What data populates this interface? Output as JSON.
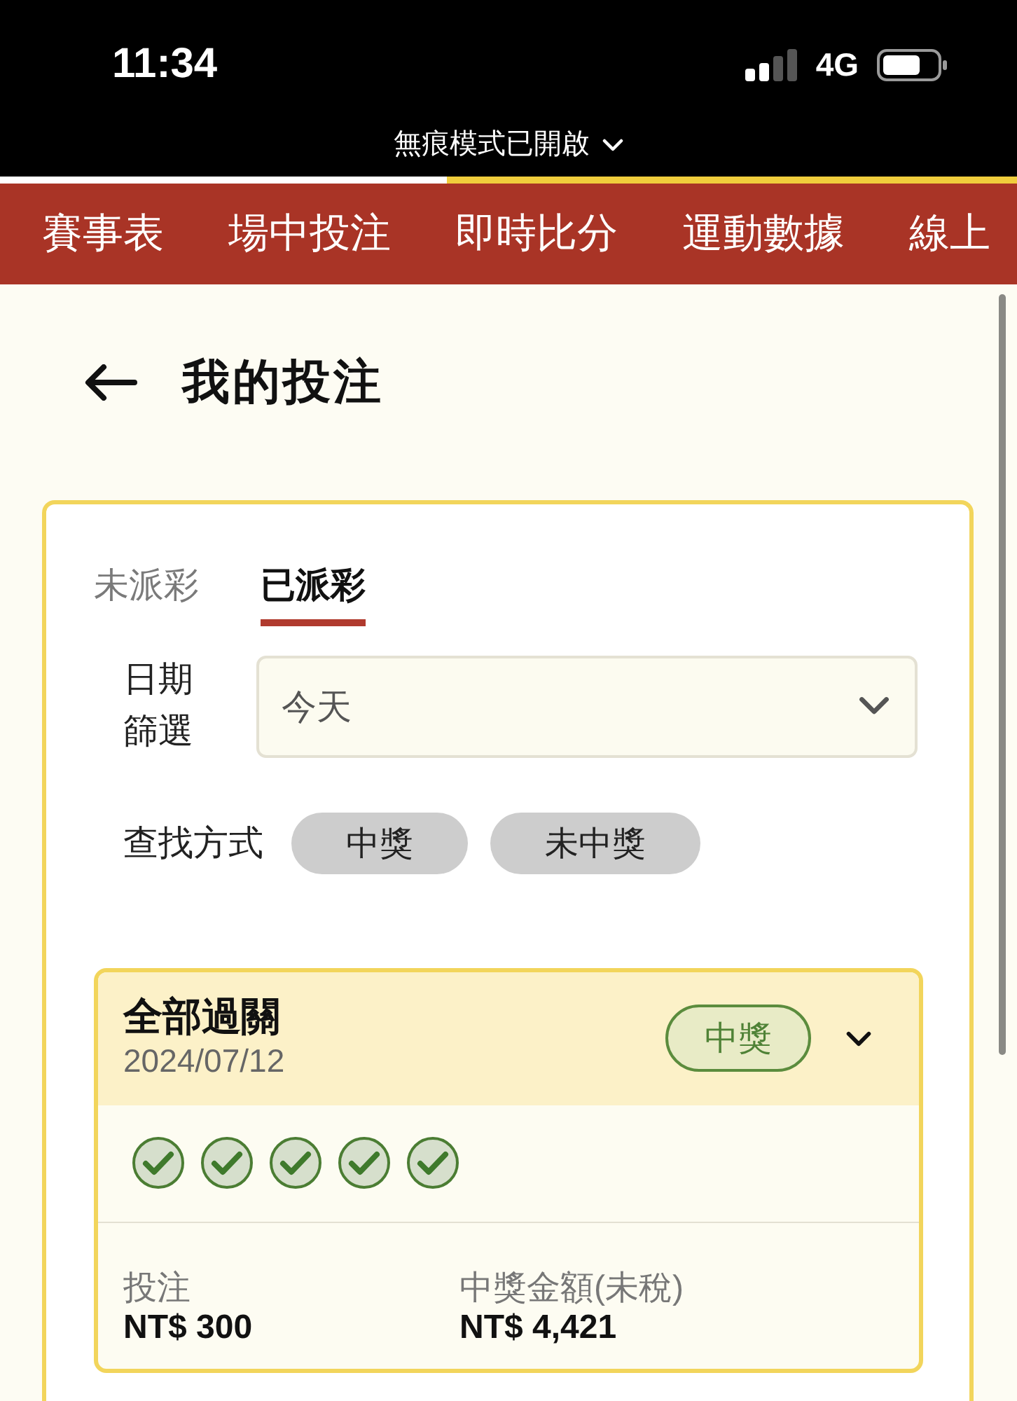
{
  "status_bar": {
    "time": "11:34",
    "network": "4G"
  },
  "incognito_banner": {
    "label": "無痕模式已開啟"
  },
  "load_progress": {
    "level": 0.44
  },
  "nav": [
    {
      "label": "賽事表",
      "selected": false
    },
    {
      "label": "場中投注",
      "selected": false
    },
    {
      "label": "即時比分",
      "selected": false
    },
    {
      "label": "運動數據",
      "selected": false
    },
    {
      "label": "線上",
      "selected": false
    }
  ],
  "page": {
    "title": "我的投注"
  },
  "tabs": [
    {
      "label": "未派彩",
      "selected": false
    },
    {
      "label": "已派彩",
      "selected": true
    }
  ],
  "date_filter": {
    "label": "日期篩選",
    "value": "今天"
  },
  "search_filter": {
    "label": "查找方式",
    "options": [
      {
        "label": "中獎",
        "selected": false
      },
      {
        "label": "未中獎",
        "selected": false
      }
    ]
  },
  "bets": [
    {
      "title": "全部過關",
      "date": "2024/07/12",
      "status": {
        "label": "中獎",
        "won": true
      },
      "legs": [
        {
          "won": true
        },
        {
          "won": true
        },
        {
          "won": true
        },
        {
          "won": true
        },
        {
          "won": true
        }
      ],
      "stake": {
        "label": "投注",
        "value": "NT$ 300"
      },
      "payout": {
        "label": "中獎金額(未稅)",
        "value": "NT$ 4,421"
      }
    }
  ]
}
